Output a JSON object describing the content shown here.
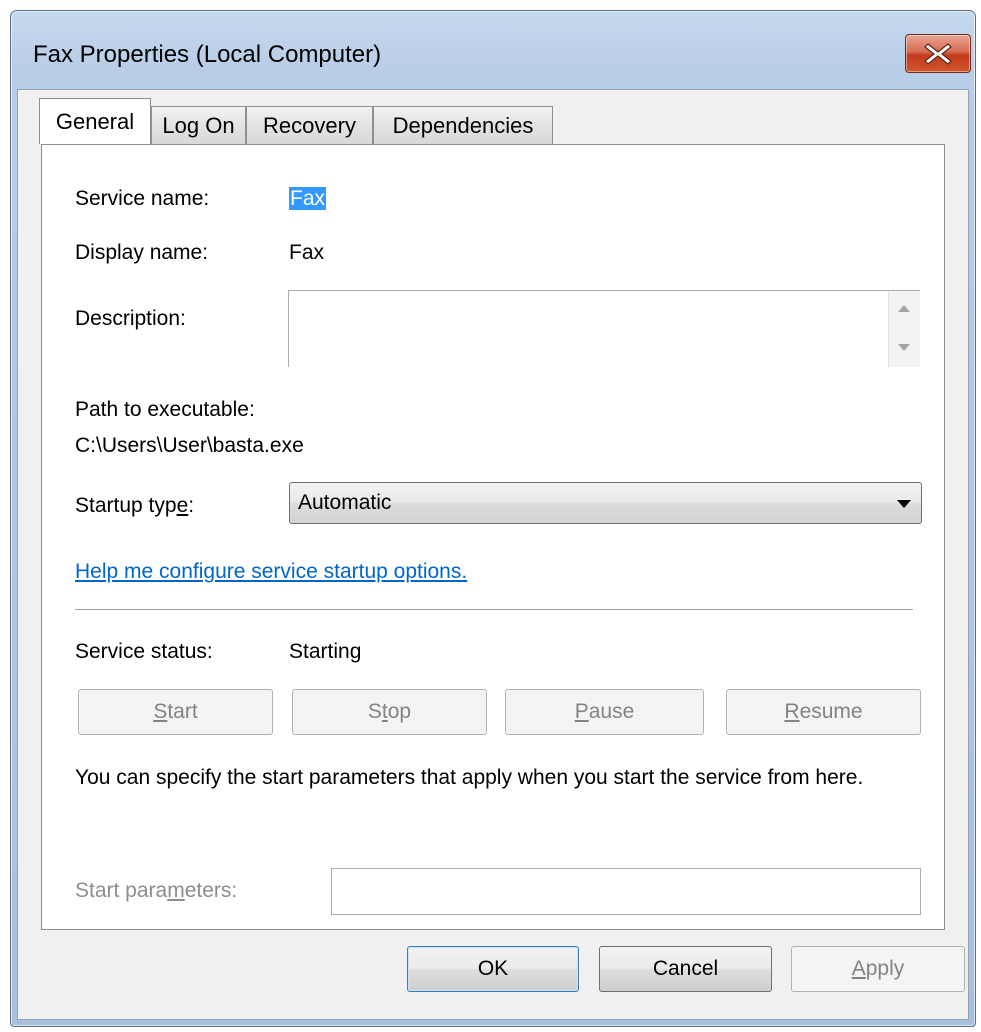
{
  "window": {
    "title": "Fax Properties (Local Computer)"
  },
  "tabs": [
    {
      "label": "General",
      "active": true
    },
    {
      "label": "Log On",
      "active": false
    },
    {
      "label": "Recovery",
      "active": false
    },
    {
      "label": "Dependencies",
      "active": false
    }
  ],
  "general": {
    "service_name_label": "Service name:",
    "service_name_value": "Fax",
    "display_name_label": "Display name:",
    "display_name_value": "Fax",
    "description_label": "Description:",
    "description_value": "",
    "path_label": "Path to executable:",
    "path_value": "C:\\Users\\User\\basta.exe",
    "startup_label_pre": "Startup typ",
    "startup_label_key": "e",
    "startup_label_post": ":",
    "startup_value": "Automatic",
    "help_link": "Help me configure service startup options.",
    "status_label": "Service status:",
    "status_value": "Starting",
    "start_key": "S",
    "start_rest": "tart",
    "stop_pre": "S",
    "stop_key": "t",
    "stop_rest": "op",
    "pause_key": "P",
    "pause_rest": "ause",
    "resume_key": "R",
    "resume_rest": "esume",
    "params_note": "You can specify the start parameters that apply when you start the service from here.",
    "params_label_pre": "Start para",
    "params_label_key": "m",
    "params_label_post": "eters:",
    "params_value": ""
  },
  "footer": {
    "ok_label": "OK",
    "cancel_label": "Cancel",
    "apply_key": "A",
    "apply_rest": "pply"
  },
  "colors": {
    "selection": "#3399ff",
    "link": "#0066cc",
    "close_button": "#c23c1c"
  },
  "icons": {
    "close": "close-icon",
    "scroll_up": "arrow-up-icon",
    "scroll_down": "arrow-down-icon",
    "dropdown": "chevron-down-icon"
  }
}
